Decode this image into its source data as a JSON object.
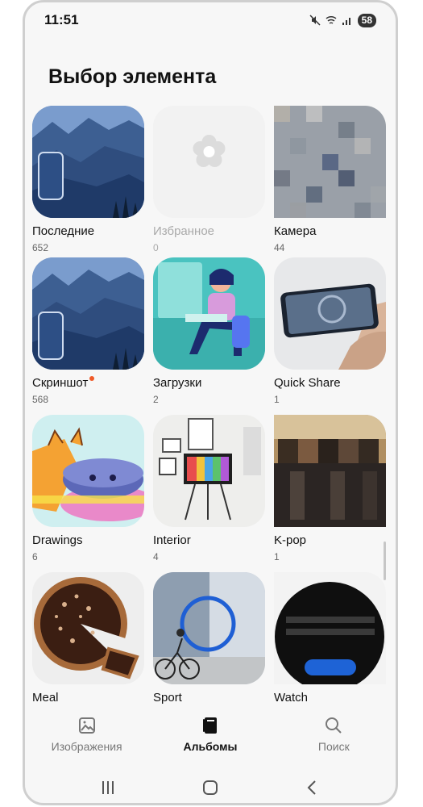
{
  "status": {
    "time": "11:51",
    "battery": "58"
  },
  "page": {
    "title": "Выбор элемента"
  },
  "albums": [
    {
      "name": "Последние",
      "count": "652"
    },
    {
      "name": "Избранное",
      "count": "0"
    },
    {
      "name": "Камера",
      "count": "44"
    },
    {
      "name": "Скриншот",
      "count": "568"
    },
    {
      "name": "Загрузки",
      "count": "2"
    },
    {
      "name": "Quick Share",
      "count": "1"
    },
    {
      "name": "Drawings",
      "count": "6"
    },
    {
      "name": "Interior",
      "count": "4"
    },
    {
      "name": "K-pop",
      "count": "1"
    },
    {
      "name": "Meal",
      "count": ""
    },
    {
      "name": "Sport",
      "count": ""
    },
    {
      "name": "Watch",
      "count": ""
    }
  ],
  "nav": {
    "images": "Изображения",
    "albums": "Альбомы",
    "search": "Поиск"
  },
  "colors": {
    "accent_dot": "#f05a28",
    "active_nav": "#111111",
    "inactive_nav": "#777777"
  }
}
